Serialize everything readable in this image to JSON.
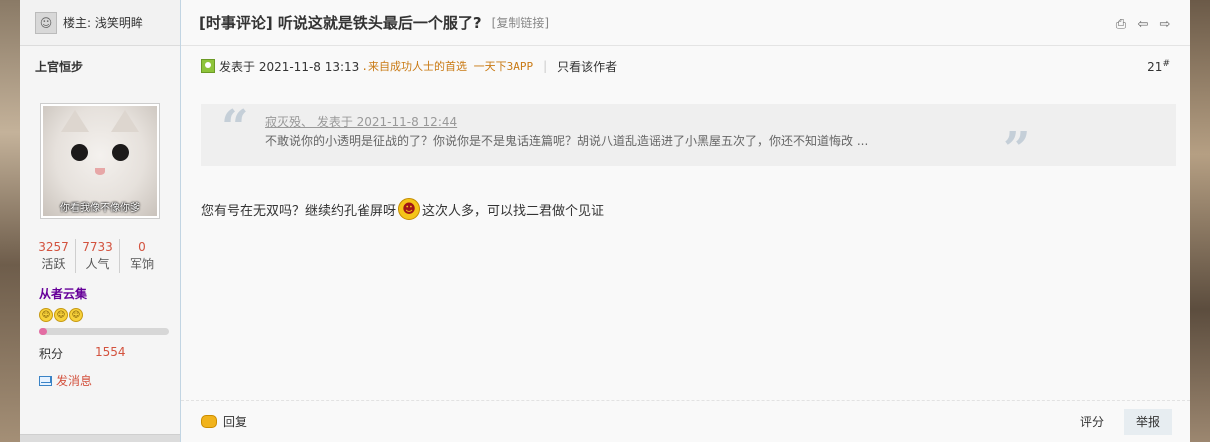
{
  "sidebar": {
    "owner_label": "楼主: 浅笑明眸",
    "author": "上官恒步",
    "avatar_caption": "你看我像不像你爹",
    "stats": [
      {
        "value": "3257",
        "label": "活跃"
      },
      {
        "value": "7733",
        "label": "人气"
      },
      {
        "value": "0",
        "label": "军饷"
      }
    ],
    "group": "从者云集",
    "level_progress": 0.06,
    "score_label": "积分",
    "score_value": "1554",
    "message_label": "发消息"
  },
  "post": {
    "title": "[时事评论] 听说这就是铁头最后一个服了?",
    "copy_link": "[复制链接]",
    "posted": "发表于  2021-11-8 13:13",
    "source": ".来自成功人士的首选 一天下3APP",
    "only_author": "只看该作者",
    "floor": "21",
    "floor_mark": "#",
    "quote_head": "寂灭殁、 发表于 2021-11-8 12:44",
    "quote_text": "不敢说你的小透明是征战的了？你说你是不是鬼话连篇呢？胡说八道乱造谣进了小黑屋五次了，你还不知道悔改 ...",
    "body_before": "您有号在无双吗？继续约孔雀屏呀",
    "body_after": "这次人多，可以找二君做个见证"
  },
  "actions": {
    "reply": "回复",
    "rate": "评分",
    "report": "举报"
  },
  "icons": [
    "print-icon",
    "prev-arrow-icon",
    "next-arrow-icon",
    "online-icon",
    "mail-icon",
    "reply-icon",
    "emoji-icon"
  ]
}
